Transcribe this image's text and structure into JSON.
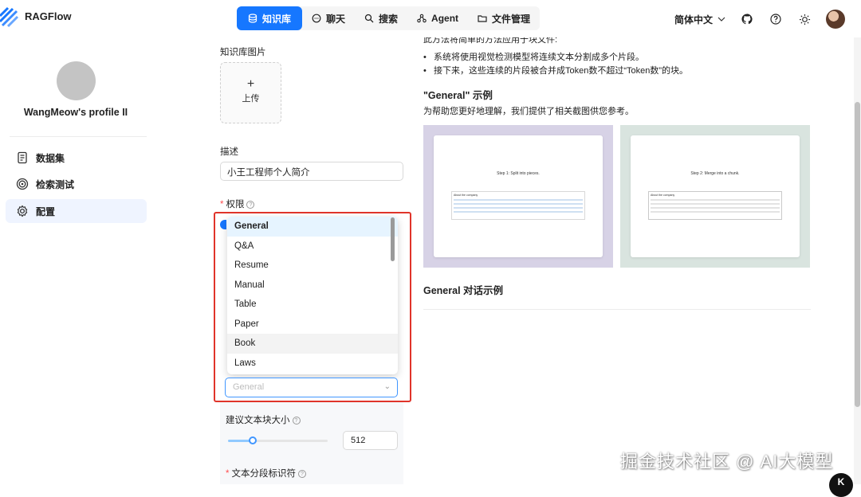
{
  "app": {
    "name": "RAGFlow"
  },
  "nav": [
    {
      "label": "知识库",
      "icon": "database-icon"
    },
    {
      "label": "聊天",
      "icon": "chat-icon"
    },
    {
      "label": "搜索",
      "icon": "search-icon"
    },
    {
      "label": "Agent",
      "icon": "agent-icon"
    },
    {
      "label": "文件管理",
      "icon": "folder-icon"
    }
  ],
  "header": {
    "language": "简体中文"
  },
  "sidebar": {
    "profile_name": "WangMeow's profile II",
    "items": [
      {
        "label": "数据集",
        "icon": "file-icon"
      },
      {
        "label": "检索测试",
        "icon": "target-icon"
      },
      {
        "label": "配置",
        "icon": "gear-icon"
      }
    ]
  },
  "form": {
    "image_label": "知识库图片",
    "upload_label": "上传",
    "description_label": "描述",
    "description_value": "小王工程师个人简介",
    "permission_label": "权限",
    "parser_options": [
      "General",
      "Q&A",
      "Resume",
      "Manual",
      "Table",
      "Paper",
      "Book",
      "Laws"
    ],
    "parser_selected": "General",
    "parser_placeholder": "General",
    "chunk_size_label": "建议文本块大小",
    "chunk_size_value": "512",
    "delimiter_label": "文本分段标识符"
  },
  "right": {
    "top_cut_text": "此方法将简单的方法应用于块文件:",
    "bullet1": "系统将使用视觉检测模型将连续文本分割成多个片段。",
    "bullet2": "接下来，这些连续的片段被合并成Token数不超过“Token数”的块。",
    "example_title": "\"General\" 示例",
    "example_desc": "为帮助您更好地理解，我们提供了相关截图供您参考。",
    "card1": {
      "step": "Step 1: Split into pieces.",
      "doc_title": "About the company",
      "bg": "#d7d2e6"
    },
    "card2": {
      "step": "Step 2: Merge into a chunk.",
      "doc_title": "About the company",
      "bg": "#d9e4df"
    },
    "dialog_title": "General 对话示例"
  },
  "watermark": "掘金技术社区 @ AI大模型",
  "corner_badge": "K"
}
